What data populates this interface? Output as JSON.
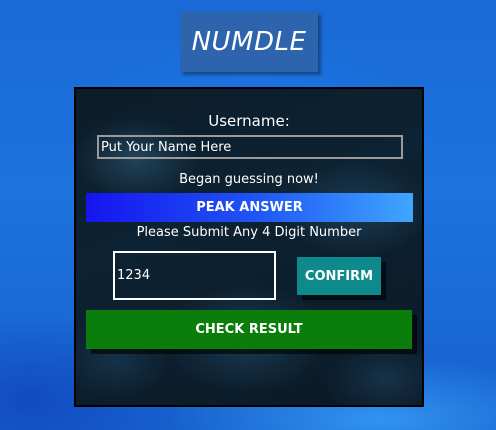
{
  "app": {
    "title": "NUMDLE"
  },
  "form": {
    "username_label": "Username:",
    "username_placeholder": "Put Your Name Here",
    "username_value": "",
    "guess_status": "Began guessing now!",
    "peak_label": "PEAK ANSWER",
    "submit_prompt": "Please Submit Any 4 Digit Number",
    "number_value": "1234",
    "confirm_label": "CONFIRM",
    "check_label": "CHECK RESULT"
  },
  "colors": {
    "title_bg": "#2e64ad",
    "peak_gradient_start": "#1515ee",
    "peak_gradient_end": "#3fa6ff",
    "confirm_bg": "#0f8a8c",
    "check_bg": "#0a7d0a",
    "panel_bg": "#0d2232",
    "desktop_bg": "#1d73de"
  }
}
